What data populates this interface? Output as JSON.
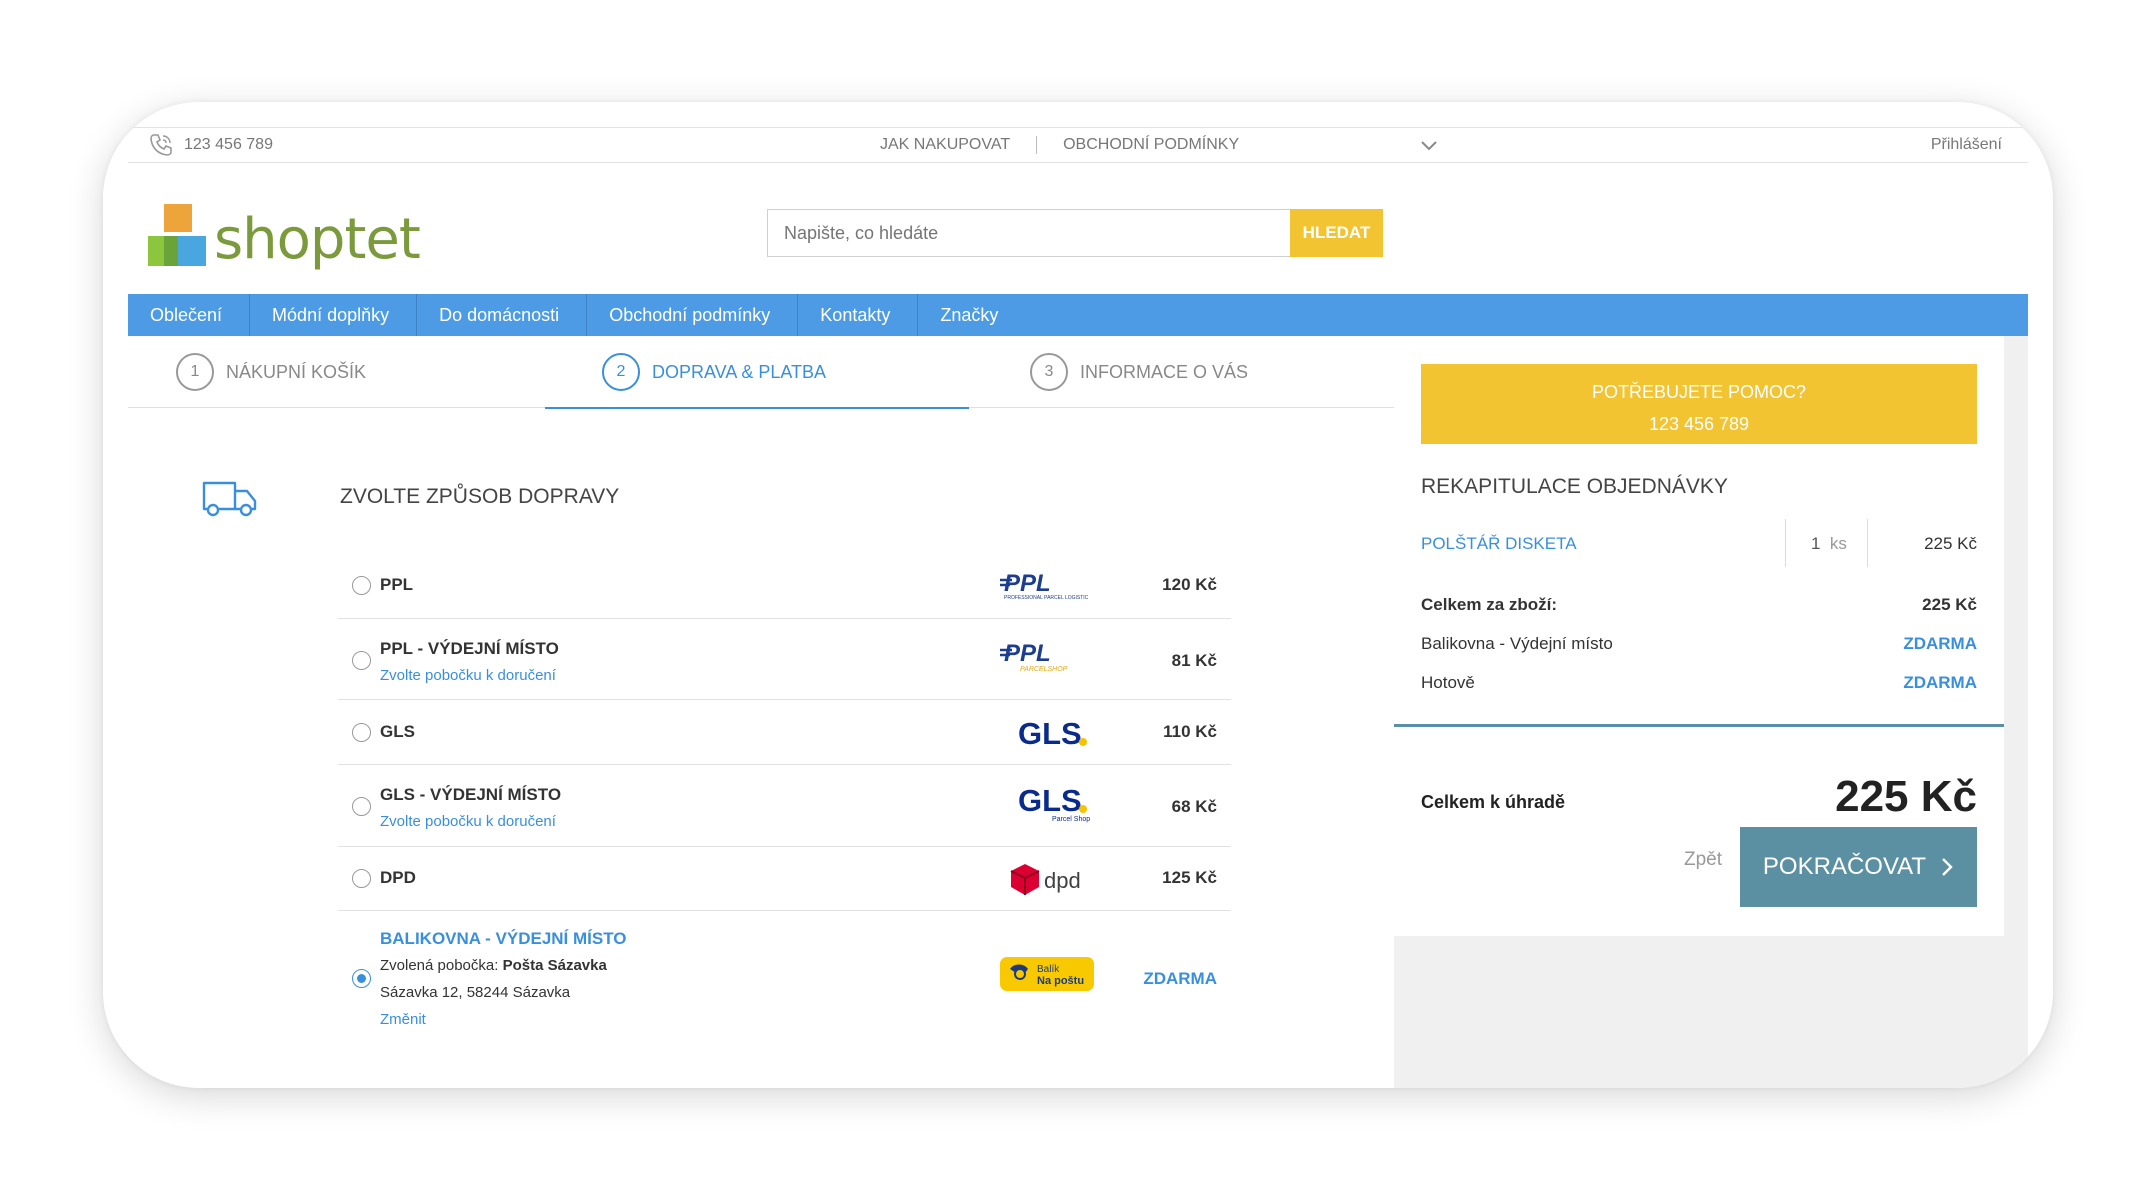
{
  "topbar": {
    "phone": "123 456 789",
    "nav": [
      "JAK NAKUPOVAT",
      "OBCHODNÍ PODMÍNKY"
    ],
    "login": "Přihlášení"
  },
  "header": {
    "logo_text": "shoptet",
    "search_placeholder": "Napište, co hledáte",
    "search_button": "HLEDAT"
  },
  "menu": [
    "Oblečení",
    "Módní doplňky",
    "Do domácnosti",
    "Obchodní podmínky",
    "Kontakty",
    "Značky"
  ],
  "steps": [
    {
      "num": "1",
      "label": "NÁKUPNÍ KOŠÍK",
      "active": false
    },
    {
      "num": "2",
      "label": "DOPRAVA & PLATBA",
      "active": true
    },
    {
      "num": "3",
      "label": "INFORMACE O VÁS",
      "active": false
    }
  ],
  "shipping": {
    "title": "ZVOLTE ZPŮSOB DOPRAVY",
    "options": [
      {
        "name": "PPL",
        "price": "120 Kč",
        "carrier": "ppl"
      },
      {
        "name": "PPL - VÝDEJNÍ MÍSTO",
        "sub": "Zvolte pobočku k doručení",
        "price": "81 Kč",
        "carrier": "ppl-parcelshop"
      },
      {
        "name": "GLS",
        "price": "110 Kč",
        "carrier": "gls"
      },
      {
        "name": "GLS - VÝDEJNÍ MÍSTO",
        "sub": "Zvolte pobočku k doručení",
        "price": "68 Kč",
        "carrier": "gls-parcelshop"
      },
      {
        "name": "DPD",
        "price": "125 Kč",
        "carrier": "dpd"
      },
      {
        "name": "BALIKOVNA - VÝDEJNÍ MÍSTO",
        "selected_prefix": "Zvolená pobočka: ",
        "selected_branch": "Pošta Sázavka",
        "address": "Sázavka 12, 58244 Sázavka",
        "change": "Změnit",
        "price": "ZDARMA",
        "carrier": "balik-na-postu"
      }
    ],
    "carrier_labels": {
      "ppl": "PPL",
      "ppl_small": "PROFESSIONAL PARCEL LOGISTIC",
      "ppl_shop": "PARCELSHOP",
      "gls": "GLS",
      "gls_shop": "Parcel Shop",
      "dpd": "dpd",
      "balik_top": "Balík",
      "balik_bottom": "Na poštu"
    }
  },
  "sidebar": {
    "help_title": "POTŘEBUJETE POMOC?",
    "help_phone": "123 456 789",
    "recap_title": "REKAPITULACE OBJEDNÁVKY",
    "item": {
      "name": "POLŠTÁŘ DISKETA",
      "qty": "1",
      "unit": "ks",
      "price": "225 Kč"
    },
    "summary": [
      {
        "label": "Celkem za zboží:",
        "value": "225 Kč",
        "bold_label": true
      },
      {
        "label": "Balikovna - Výdejní místo",
        "value": "ZDARMA",
        "bold_label": false
      },
      {
        "label": "Hotově",
        "value": "ZDARMA",
        "bold_label": false
      }
    ],
    "total_label": "Celkem k úhradě",
    "total_value": "225 Kč",
    "back": "Zpět",
    "continue": "POKRAČOVAT"
  },
  "colors": {
    "accent": "#4d9be4",
    "link": "#3a8fdd",
    "yellow": "#f3c432",
    "continue": "#5b8fa2"
  }
}
